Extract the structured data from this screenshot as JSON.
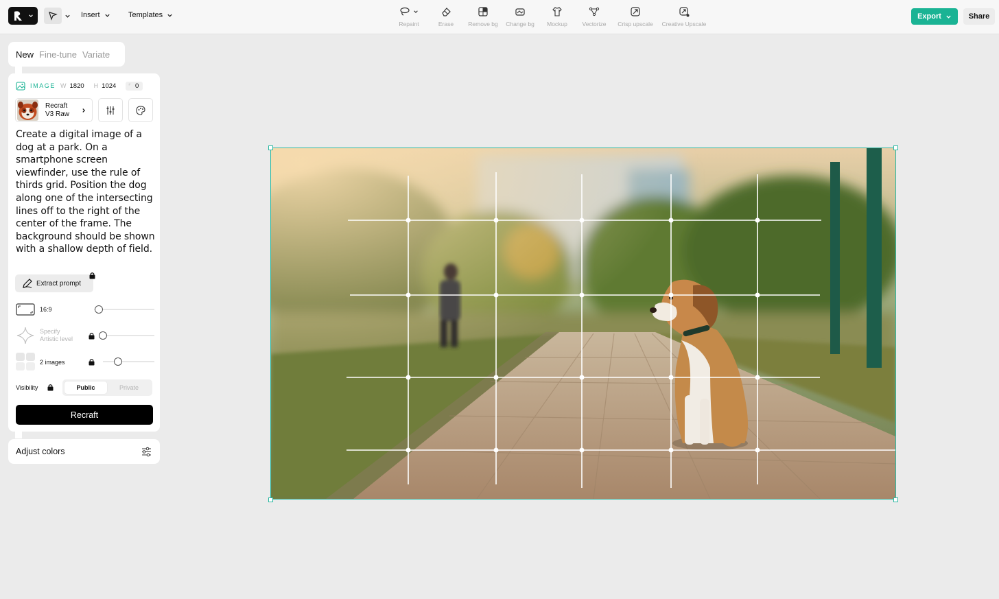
{
  "topbar": {
    "menus": [
      "Insert",
      "Templates"
    ],
    "tools": [
      {
        "label": "Repaint",
        "icon": "lasso-icon"
      },
      {
        "label": "Erase",
        "icon": "eraser-icon"
      },
      {
        "label": "Remove bg",
        "icon": "remove-bg-icon"
      },
      {
        "label": "Change bg",
        "icon": "change-bg-icon"
      },
      {
        "label": "Mockup",
        "icon": "shirt-icon"
      },
      {
        "label": "Vectorize",
        "icon": "vector-icon"
      },
      {
        "label": "Crisp upscale",
        "icon": "crisp-upscale-icon"
      },
      {
        "label": "Creative Upscale",
        "icon": "creative-upscale-icon"
      }
    ],
    "export_label": "Export",
    "share_label": "Share"
  },
  "tabs": [
    {
      "label": "New",
      "active": true
    },
    {
      "label": "Fine-tune",
      "active": false
    },
    {
      "label": "Variate",
      "active": false
    }
  ],
  "panel": {
    "image_label": "IMAGE",
    "width_label": "W",
    "width_value": "1820",
    "height_label": "H",
    "height_value": "1024",
    "seed_value": "0",
    "model": {
      "line1": "Recraft",
      "line2": "V3 Raw"
    },
    "prompt": "Create a digital image of a dog at a park. On a smartphone screen viewfinder, use the rule of thirds grid. Position the dog along one of the intersecting lines off to the right of the center of the frame. The background should be shown with a shallow depth of field.",
    "extract_label": "Extract prompt",
    "aspect_label": "16:9",
    "artistic_label_1": "Specify",
    "artistic_label_2": "Artistic level",
    "images_label": "2 images",
    "visibility_label": "Visibility",
    "visibility_options": [
      "Public",
      "Private"
    ],
    "recraft_label": "Recraft"
  },
  "adjust_label": "Adjust colors",
  "colors": {
    "accent": "#1ab394",
    "frame": "#2fb9a3"
  }
}
